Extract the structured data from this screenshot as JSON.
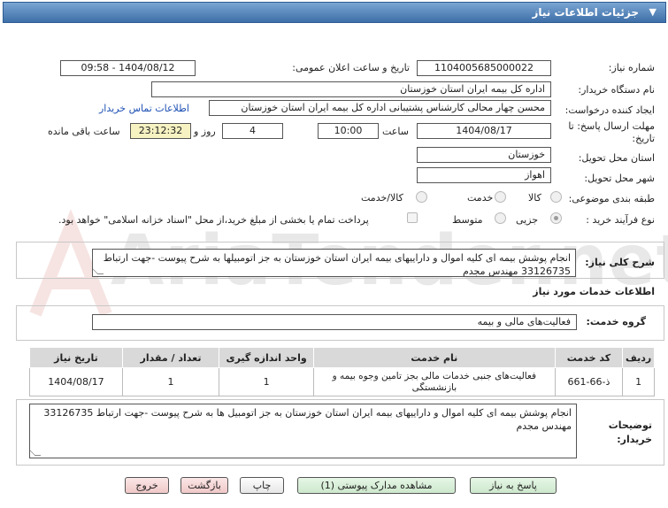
{
  "header": {
    "title": "جزئیات اطلاعات نیاز"
  },
  "fields": {
    "need_number_label": "شماره نیاز:",
    "need_number": "1104005685000022",
    "announce_label": "تاریخ و ساعت اعلان عمومی:",
    "announce_value": "1404/08/12 - 09:58",
    "buyer_org_label": "نام دستگاه خریدار:",
    "buyer_org": "اداره کل بیمه ایران استان خوزستان",
    "creator_label": "ایجاد کننده درخواست:",
    "creator": "محسن چهار محالی کارشناس پشتیبانی اداره کل بیمه ایران استان خوزستان",
    "contact_link": "اطلاعات تماس خریدار",
    "deadline_label": "مهلت ارسال پاسخ: تا تاریخ:",
    "deadline_date": "1404/08/17",
    "time_label": "ساعت",
    "deadline_time": "10:00",
    "days_value": "4",
    "days_label": "روز و",
    "remaining_value": "23:12:32",
    "remaining_label": "ساعت باقی مانده",
    "province_label": "استان محل تحویل:",
    "province": "خوزستان",
    "city_label": "شهر محل تحویل:",
    "city": "اهواز",
    "category_label": "طبقه بندی موضوعی:",
    "category_options": [
      "کالا",
      "خدمت",
      "کالا/خدمت"
    ],
    "process_label": "نوع فرآیند خرید :",
    "process_options": [
      "جزیی",
      "متوسط"
    ],
    "payment_note": "پرداخت تمام یا بخشی از مبلغ خرید،از محل \"اسناد خزانه اسلامی\" خواهد بود."
  },
  "summary": {
    "label": "شرح کلی نیاز:",
    "text": "انجام پوشش بیمه ای کلیه اموال و داراییهای بیمه ایران استان خوزستان به جز اتومبیلها به شرح پیوست -جهت ارتباط 33126735 مهندس مجدم"
  },
  "services": {
    "title": "اطلاعات خدمات مورد نیاز",
    "group_label": "گروه خدمت:",
    "group_value": "فعالیت‌های مالی و بیمه",
    "columns": [
      "ردیف",
      "کد خدمت",
      "نام خدمت",
      "واحد اندازه گیری",
      "تعداد / مقدار",
      "تاریخ نیاز"
    ],
    "rows": [
      {
        "row": "1",
        "code": "ذ-66-661",
        "name": "فعالیت‌های جنبی خدمات مالی بجز تامین وجوه بیمه و بازنشستگی",
        "unit": "1",
        "qty": "1",
        "date": "1404/08/17"
      }
    ]
  },
  "buyer_notes": {
    "label": "توضیحات خریدار:",
    "text": "انجام پوشش بیمه ای کلیه اموال و داراییهای بیمه ایران استان خوزستان به جز اتومبیل ها به شرح پیوست -جهت ارتباط 33126735 مهندس مجدم"
  },
  "buttons": {
    "respond": "پاسخ به نیاز",
    "attachments": "مشاهده مدارک پیوستی (1)",
    "print": "چاپ",
    "back": "بازگشت",
    "exit": "خروج"
  },
  "watermark": "AriaTender.net",
  "colors": {
    "header": "#3e6fa8",
    "remaining_bg": "#f6f2c2",
    "link": "#1e50b4"
  }
}
